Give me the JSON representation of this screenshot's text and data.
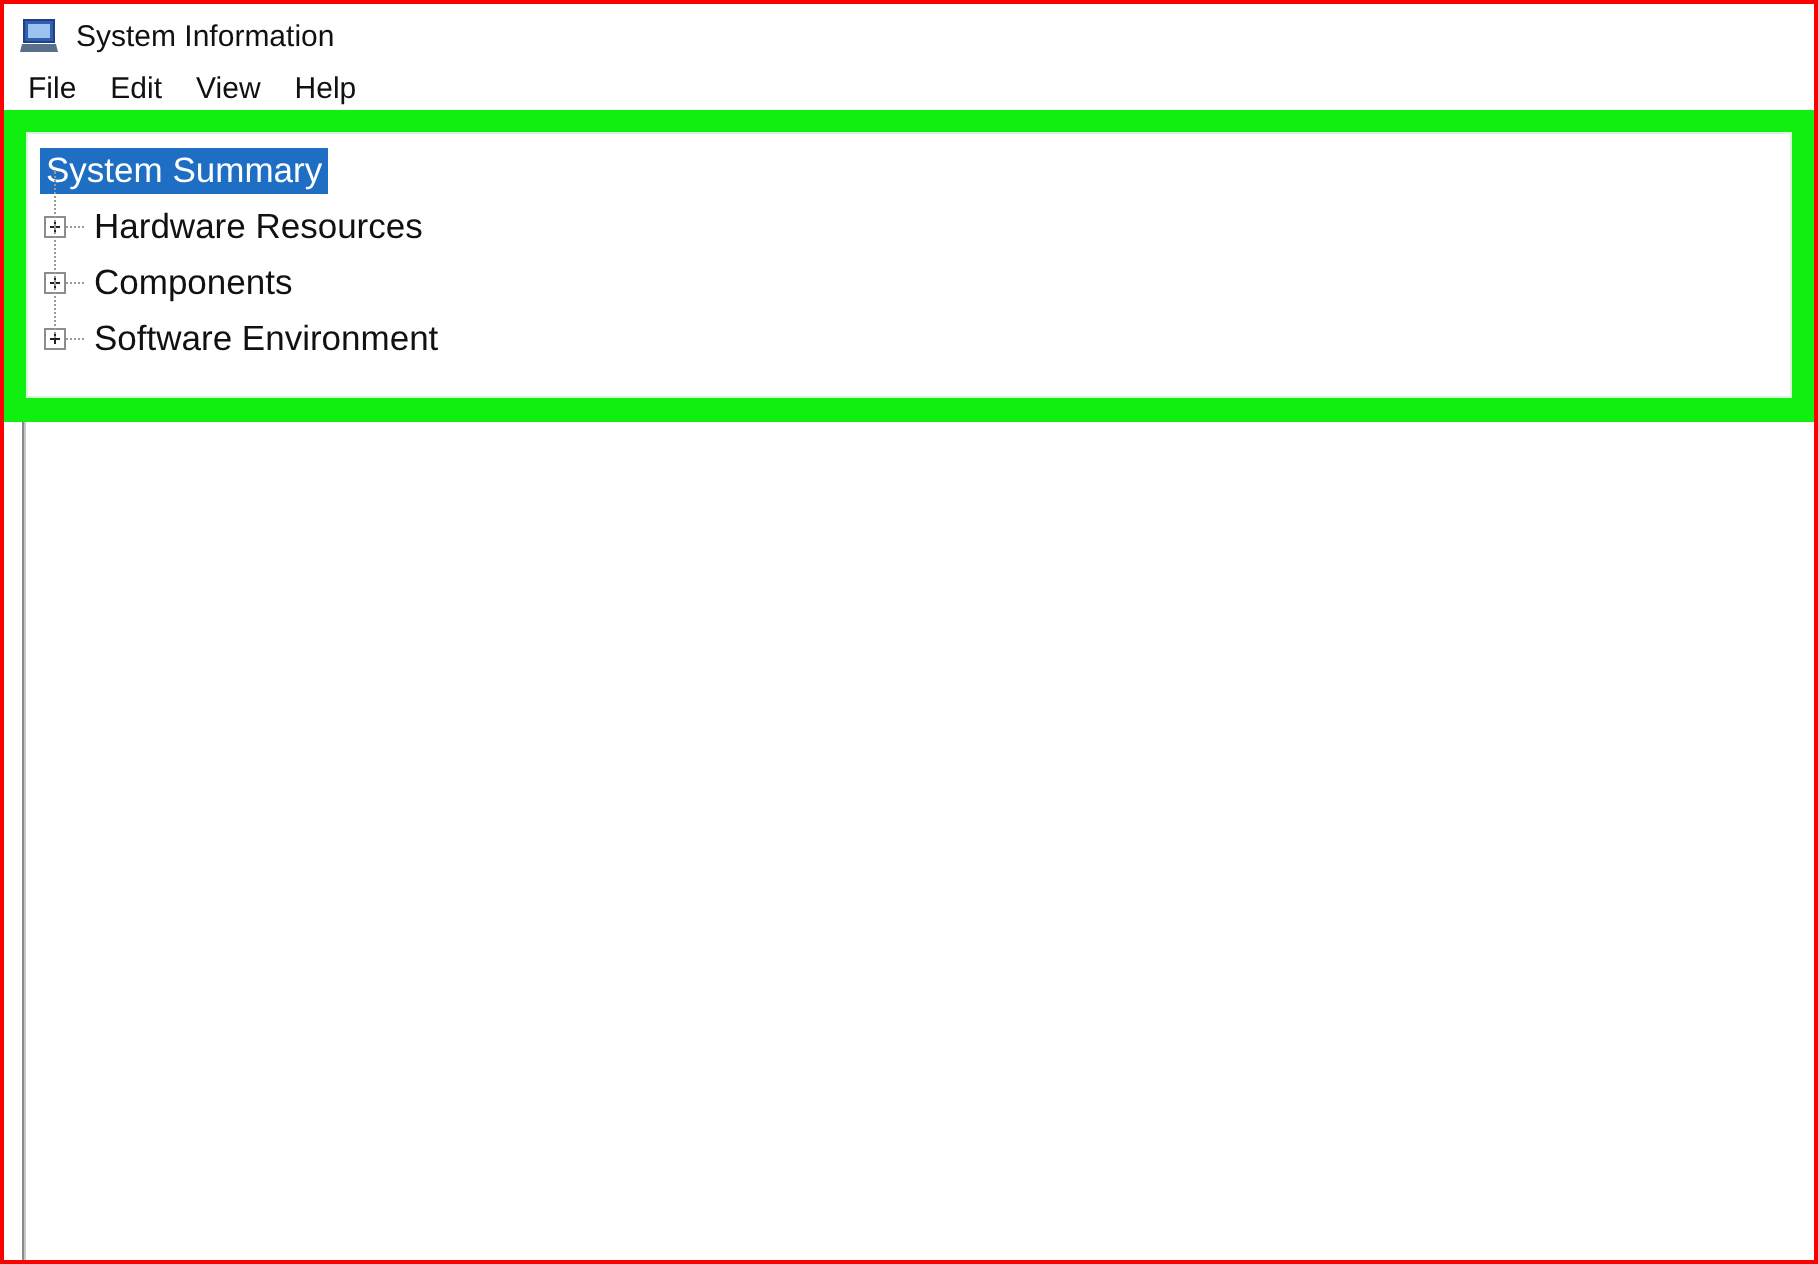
{
  "window": {
    "title": "System Information"
  },
  "menu": [
    "File",
    "Edit",
    "View",
    "Help"
  ],
  "tree": {
    "label": "System Summary",
    "selected": true,
    "children": [
      {
        "label": "Hardware Resources",
        "selected": false,
        "expanded": false
      },
      {
        "label": "Components",
        "selected": false,
        "expanded": false
      },
      {
        "label": "Software Environment",
        "selected": false,
        "expanded": false
      }
    ]
  }
}
